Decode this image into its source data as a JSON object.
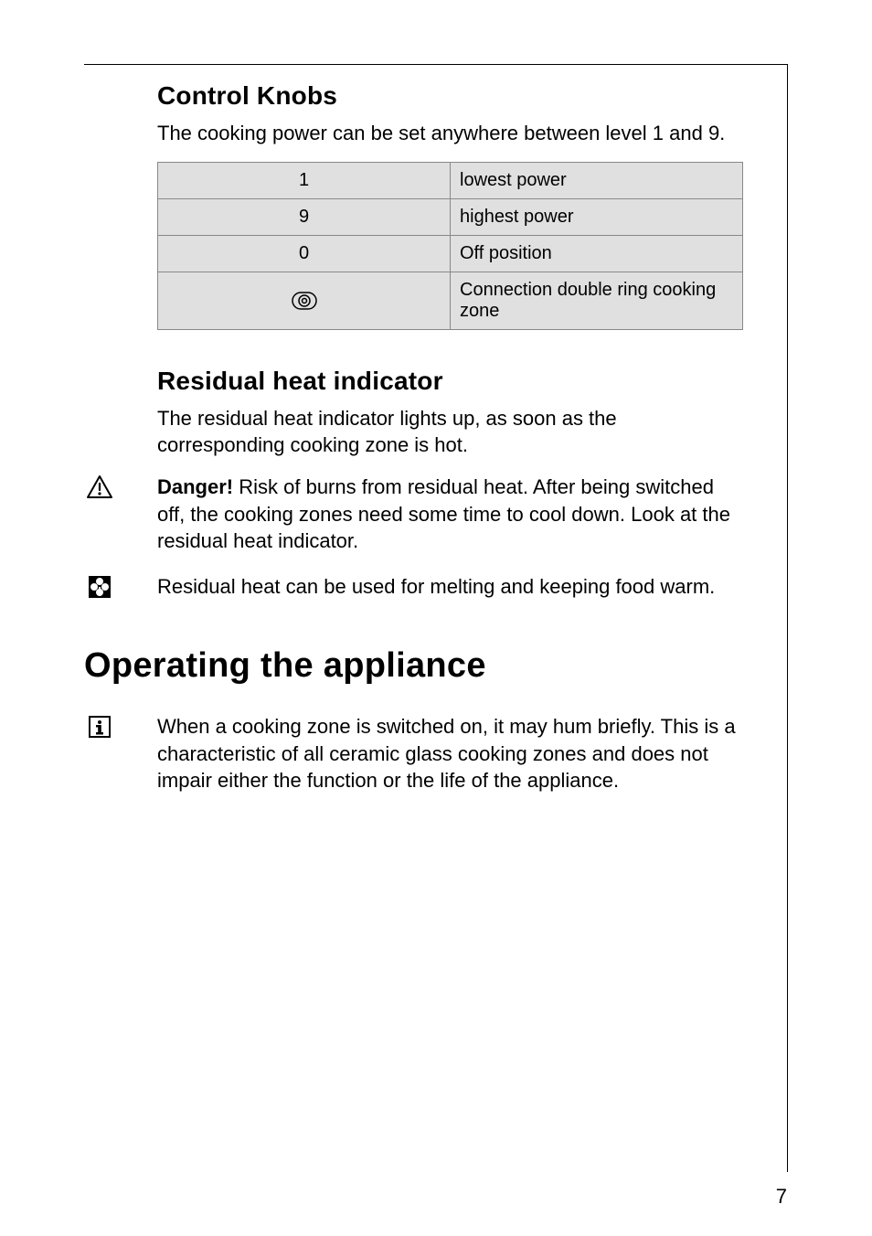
{
  "section1": {
    "title": "Control Knobs",
    "intro": "The cooking power can be set anywhere between level 1 and 9.",
    "table": [
      {
        "left": "1",
        "right": "lowest power"
      },
      {
        "left": "9",
        "right": "highest power"
      },
      {
        "left": "0",
        "right": "Off position"
      },
      {
        "left": "__ICON__",
        "right": "Connection double ring cooking zone"
      }
    ]
  },
  "section2": {
    "title": "Residual heat indicator",
    "intro": "The residual heat indicator lights up, as soon as the corresponding cooking zone is hot.",
    "danger_bold": "Danger!",
    "danger_rest": " Risk of burns from residual heat. After being switched off, the cooking zones need some time to cool down. Look at the residual heat indicator.",
    "tip": "Residual heat can be used for melting and keeping food warm."
  },
  "section3": {
    "title": "Operating the appliance",
    "info": "When a cooking zone is switched on, it may hum briefly. This is a characteristic of all ceramic glass cooking zones and does not impair either the function or the life of the appliance."
  },
  "pageNumber": "7"
}
